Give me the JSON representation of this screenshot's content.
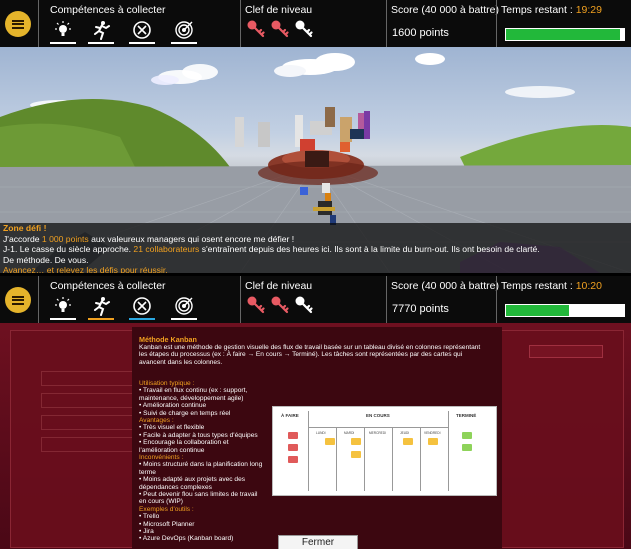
{
  "panels": [
    {
      "hud": {
        "skills_label": "Compétences à collecter",
        "keys_label": "Clef de niveau",
        "score_label": "Score (40 000 à battre)",
        "score_value": "1600 points",
        "time_label": "Temps restant : ",
        "time_value": "19:29",
        "time_progress": 0.97,
        "keys": [
          "red",
          "red",
          "white"
        ],
        "skills": [
          {
            "icon": "lightbulb-icon",
            "underline": "#ffffff"
          },
          {
            "icon": "running-person-icon",
            "underline": "#ffffff"
          },
          {
            "icon": "compass-icon",
            "underline": "#ffffff"
          },
          {
            "icon": "target-icon",
            "underline": "#ffffff"
          }
        ]
      },
      "dialog": {
        "title": "Zone défi !",
        "line1_pre": "J'accorde ",
        "line1_hl": "1 000 points",
        "line1_post": " aux valeureux managers qui osent encore me défier !",
        "line2_pre": "J-1. Le casse du siècle approche. ",
        "line2_hl": "21 collaborateurs",
        "line2_post": " s'entraînent depuis des heures ici. Ils sont à la limite du burn-out. Ils ont besoin de clarté.",
        "line3": "De méthode. De vous.",
        "cta": "Avancez… et relevez les défis pour réussir."
      }
    },
    {
      "hud": {
        "skills_label": "Compétences à collecter",
        "keys_label": "Clef de niveau",
        "score_label": "Score (40 000 à battre)",
        "score_value": "7770 points",
        "time_label": "Temps restant : ",
        "time_value": "10:20",
        "time_progress": 0.53,
        "keys": [
          "red",
          "red",
          "white"
        ],
        "skills": [
          {
            "icon": "lightbulb-icon",
            "underline": "#ffffff"
          },
          {
            "icon": "running-person-icon",
            "underline": "#f0a020"
          },
          {
            "icon": "compass-icon",
            "underline": "#2aa7e0"
          },
          {
            "icon": "target-icon",
            "underline": "#ffffff"
          }
        ]
      },
      "modal": {
        "title": "Méthode Kanban",
        "description": "Kanban est une méthode de gestion visuelle des flux de travail basée sur un tableau divisé en colonnes représentant les étapes du processus (ex : À faire → En cours → Terminé). Les tâches sont représentées par des cartes qui avancent dans les colonnes.",
        "usage_title": "Utilisation typique :",
        "usage": [
          "• Travail en flux continu (ex : support,",
          "maintenance, développement agile)",
          "• Amélioration continue",
          "• Suivi de charge en temps réel"
        ],
        "advantages_title": "Avantages :",
        "advantages": [
          "• Très visuel et flexible",
          "• Facile à adapter à tous types d'équipes",
          "• Encourage la collaboration et",
          "l'amélioration continue"
        ],
        "drawbacks_title": "Inconvénients :",
        "drawbacks": [
          "• Moins structuré dans la planification long",
          "terme",
          "• Moins adapté aux projets avec des",
          "dépendances complexes",
          "• Peut devenir flou sans limites de travail",
          "en cours (WIP)"
        ],
        "tools_title": "Exemples d'outils :",
        "tools": [
          "• Trello",
          "• Microsoft Planner",
          "• Jira",
          "• Azure DevOps (Kanban board)"
        ],
        "board": {
          "todo": "À FAIRE",
          "doing": "EN COURS",
          "done": "TERMINÉ",
          "days": [
            "LUNDI",
            "MARDI",
            "MERCREDI",
            "JEUDI",
            "VENDREDI"
          ]
        },
        "close_label": "Fermer"
      }
    }
  ]
}
